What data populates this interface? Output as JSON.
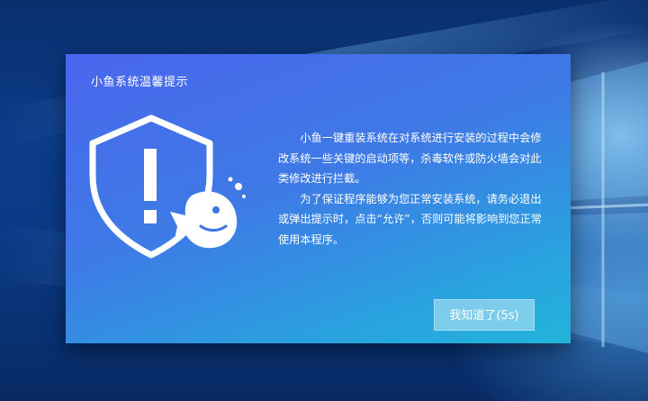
{
  "dialog": {
    "title": "小鱼系统温馨提示",
    "paragraph_1": "小鱼一键重装系统在对系统进行安装的过程中会修改系统一些关键的启动项等，杀毒软件或防火墙会对此类修改进行拦截。",
    "paragraph_2": "为了保证程序能够为您正常安装系统，请务必退出或弹出提示时，点击“允许”，否则可能将影响到您正常使用本程序。",
    "button_label": "我知道了(5s)",
    "icon": "shield-warning-fish-icon"
  },
  "colors": {
    "dialog_gradient_start": "#4a66ee",
    "dialog_gradient_end": "#22b4da",
    "text": "#ffffff"
  }
}
